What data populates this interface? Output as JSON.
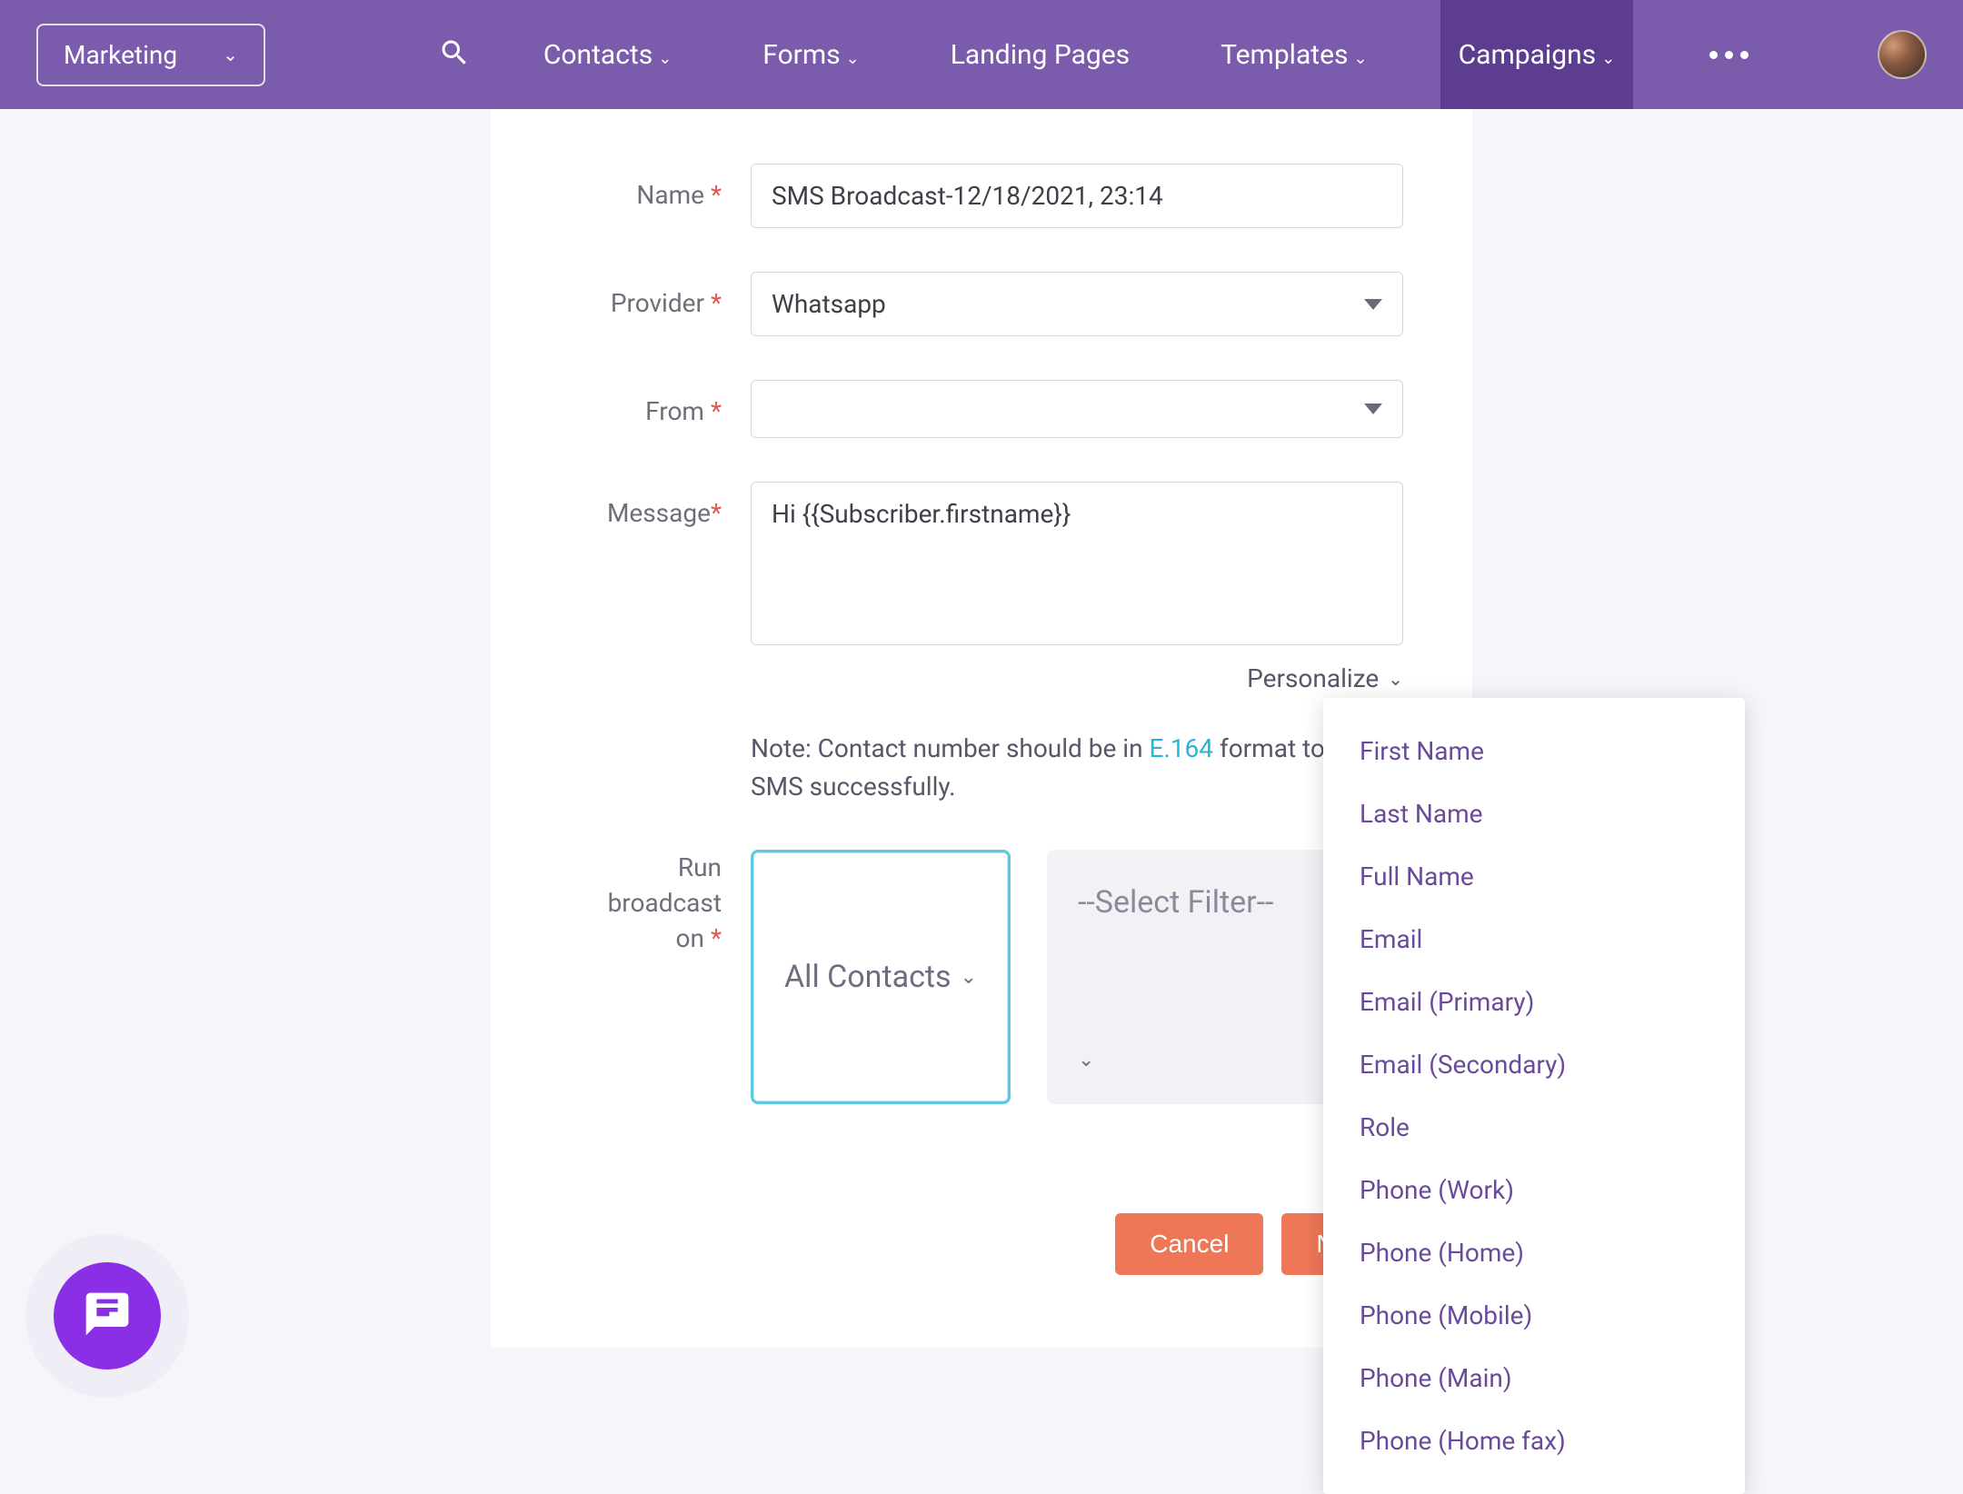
{
  "nav": {
    "app_switcher": "Marketing",
    "items": [
      "Contacts",
      "Forms",
      "Landing Pages",
      "Templates",
      "Campaigns"
    ],
    "active_index": 4
  },
  "form": {
    "name_label": "Name",
    "name_value": "SMS Broadcast-12/18/2021, 23:14",
    "provider_label": "Provider",
    "provider_value": "Whatsapp",
    "from_label": "From",
    "from_value": "",
    "message_label": "Message",
    "message_value": "Hi {{Subscriber.firstname}}",
    "personalize_label": "Personalize",
    "note_prefix": "Note: Contact number should be in ",
    "note_link": "E.164",
    "note_suffix": " format to send SMS successfully.",
    "broadcast_label_line1": "Run broadcast",
    "broadcast_label_line2": "on",
    "contacts_select": "All Contacts",
    "filter_select": "--Select Filter--"
  },
  "buttons": {
    "cancel": "Cancel",
    "next": "Next"
  },
  "personalize_options": [
    "First Name",
    "Last Name",
    "Full Name",
    "Email",
    "Email (Primary)",
    "Email (Secondary)",
    "Role",
    "Phone (Work)",
    "Phone (Home)",
    "Phone (Mobile)",
    "Phone (Main)",
    "Phone (Home fax)"
  ]
}
